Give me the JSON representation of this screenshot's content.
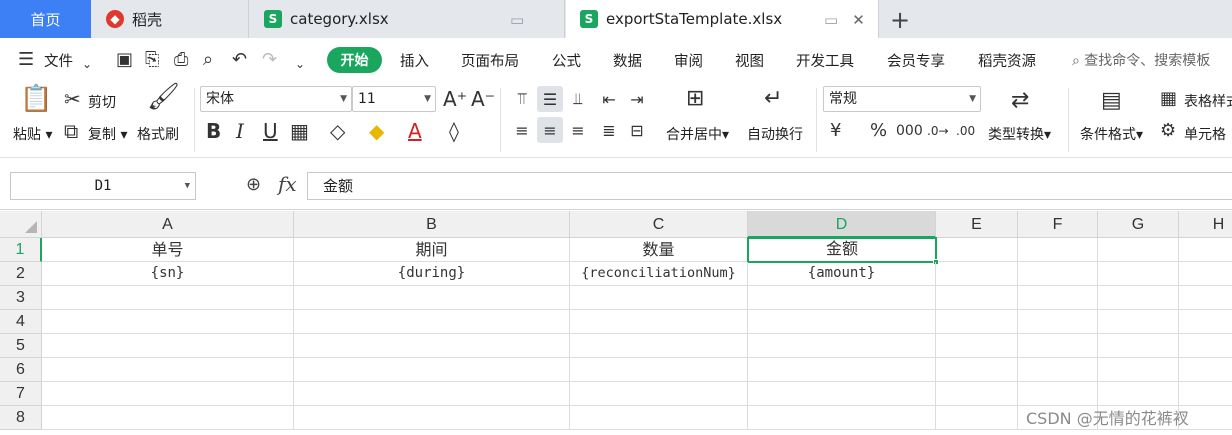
{
  "tabs": {
    "home": "首页",
    "items": [
      {
        "label": "稻壳",
        "icon": "docer-icon"
      },
      {
        "label": "category.xlsx",
        "icon": "spreadsheet-icon"
      },
      {
        "label": "exportStaTemplate.xlsx",
        "icon": "spreadsheet-icon"
      }
    ]
  },
  "menu": {
    "file": "文件",
    "items": [
      "开始",
      "插入",
      "页面布局",
      "公式",
      "数据",
      "审阅",
      "视图",
      "开发工具",
      "会员专享",
      "稻壳资源"
    ],
    "search": "查找命令、搜索模板"
  },
  "ribbon": {
    "paste": "粘贴",
    "cut": "剪切",
    "copy": "复制",
    "format_painter": "格式刷",
    "font_name": "宋体",
    "font_size": "11",
    "merge_center": "合并居中",
    "wrap_text": "自动换行",
    "number_format": "常规",
    "convert_type": "类型转换",
    "conditional_format": "条件格式",
    "table_style": "表格样式",
    "cell_style": "单元格"
  },
  "formula_bar": {
    "name_box": "D1",
    "fx": "fx",
    "content": "金额"
  },
  "sheet": {
    "columns": [
      "A",
      "B",
      "C",
      "D",
      "E",
      "F",
      "G",
      "H"
    ],
    "rows": [
      "1",
      "2",
      "3",
      "4",
      "5",
      "6",
      "7",
      "8"
    ],
    "cells": {
      "A1": "单号",
      "B1": "期间",
      "C1": "数量",
      "D1": "金额",
      "A2": "{sn}",
      "B2": "{during}",
      "C2": "{reconciliationNum}",
      "D2": "{amount}"
    },
    "selected_cell": "D1"
  },
  "watermark": "CSDN @无情的花裤衩",
  "colors": {
    "accent_green": "#1aa65e",
    "home_tab_blue": "#3d7ff5"
  }
}
